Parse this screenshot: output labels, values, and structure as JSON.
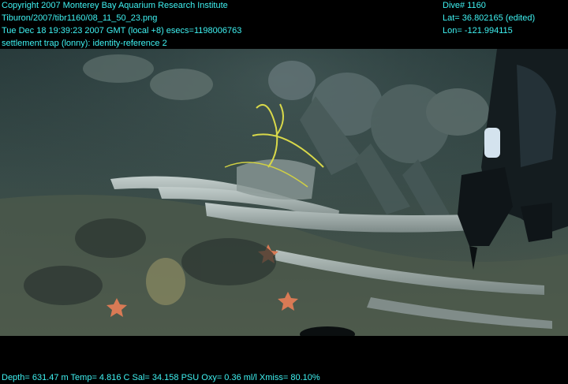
{
  "header_left": {
    "line1": "Copyright 2007 Monterey Bay Aquarium Research Institute",
    "line2": "Tiburon/2007/tibr1160/08_11_50_23.png",
    "line3": "Tue Dec 18 19:39:23 2007 GMT (local +8)  esecs=1198006763",
    "line4": "settlement trap (lonny): identity-reference 2"
  },
  "header_right": {
    "dive": "Dive# 1160",
    "lat": "Lat= 36.802165 (edited)",
    "lon": "Lon= -121.994115"
  },
  "footer": {
    "telemetry": "Depth= 631.47 m  Temp= 4.816 C  Sal= 34.158 PSU  Oxy= 0.36 ml/l  Xmiss= 80.10%"
  },
  "colors": {
    "overlay_text": "#3ff2f2",
    "water": "#2f4443",
    "sediment": "#4a574a",
    "bone": "#9aa7a6"
  }
}
